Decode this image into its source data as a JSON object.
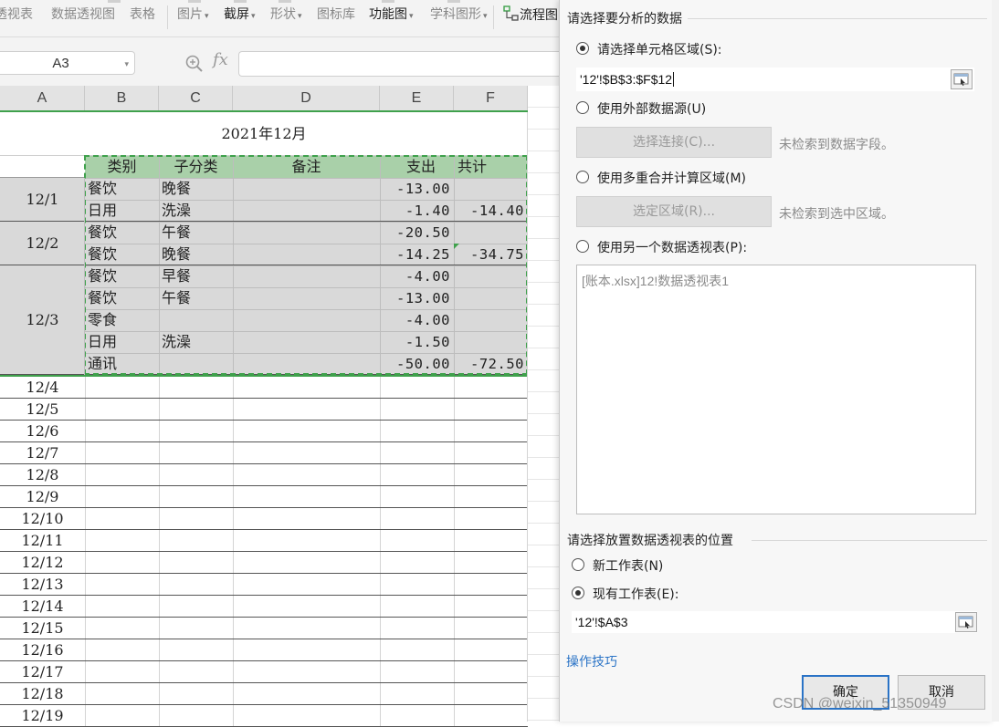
{
  "ribbon": {
    "items": [
      {
        "label": "透视表",
        "dim": true
      },
      {
        "label": "数据透视图",
        "dim": true
      },
      {
        "label": "表格",
        "dim": true
      },
      {
        "label": "图片",
        "dim": true,
        "chevron": true
      },
      {
        "label": "截屏",
        "dim": false,
        "chevron": true
      },
      {
        "label": "形状",
        "dim": true,
        "chevron": true
      },
      {
        "label": "图标库",
        "dim": true
      },
      {
        "label": "功能图",
        "dim": false,
        "chevron": true
      },
      {
        "label": "学科图形",
        "dim": true,
        "chevron": true
      },
      {
        "label": "流程图",
        "dim": false
      }
    ]
  },
  "formula_bar": {
    "name_box": "A3",
    "fx": "fx"
  },
  "sheet": {
    "columns": [
      "A",
      "B",
      "C",
      "D",
      "E",
      "F"
    ],
    "title": "2021年12月",
    "headers": [
      "类别",
      "子分类",
      "备注",
      "支出",
      "共计"
    ],
    "rows": [
      {
        "cat": "餐饮",
        "sub": "晚餐",
        "amt": "-13.00",
        "total": ""
      },
      {
        "cat": "日用",
        "sub": "洗澡",
        "amt": "-1.40",
        "total": "-14.40"
      },
      {
        "cat": "餐饮",
        "sub": "午餐",
        "amt": "-20.50",
        "total": ""
      },
      {
        "cat": "餐饮",
        "sub": "晚餐",
        "amt": "-14.25",
        "total": "-34.75"
      },
      {
        "cat": "餐饮",
        "sub": "早餐",
        "amt": "-4.00",
        "total": ""
      },
      {
        "cat": "餐饮",
        "sub": "午餐",
        "amt": "-13.00",
        "total": ""
      },
      {
        "cat": "零食",
        "sub": "",
        "amt": "-4.00",
        "total": ""
      },
      {
        "cat": "日用",
        "sub": "洗澡",
        "amt": "-1.50",
        "total": ""
      },
      {
        "cat": "通讯",
        "sub": "",
        "amt": "-50.00",
        "total": "-72.50"
      }
    ],
    "date_groups": [
      {
        "label": "12/1",
        "rows": 2
      },
      {
        "label": "12/2",
        "rows": 2
      },
      {
        "label": "12/3",
        "rows": 5
      }
    ],
    "later_dates": [
      "12/4",
      "12/5",
      "12/6",
      "12/7",
      "12/8",
      "12/9",
      "12/10",
      "12/11",
      "12/12",
      "12/13",
      "12/14",
      "12/15",
      "12/16",
      "12/17",
      "12/18",
      "12/19"
    ]
  },
  "dialog": {
    "section_source": "请选择要分析的数据",
    "opt_range": "请选择单元格区域(S):",
    "range_value": "'12'!$B$3:$F$12",
    "opt_external": "使用外部数据源(U)",
    "btn_connect": "选择连接(C)...",
    "note_connect": "未检索到数据字段。",
    "opt_multi": "使用多重合并计算区域(M)",
    "btn_region": "选定区域(R)...",
    "note_region": "未检索到选中区域。",
    "opt_other": "使用另一个数据透视表(P):",
    "pivot_list": [
      "[账本.xlsx]12!数据透视表1"
    ],
    "section_dest": "请选择放置数据透视表的位置",
    "opt_new": "新工作表(N)",
    "opt_existing": "现有工作表(E):",
    "dest_value": "'12'!$A$3",
    "tips_link": "操作技巧",
    "ok": "确定",
    "cancel": "取消"
  },
  "watermark": "CSDN @weixin_51350949",
  "colors": {
    "accent": "#3fa14c",
    "selection_fill": "#d9d9d9",
    "header_fill": "#a9d0a9",
    "link": "#2a73c6"
  }
}
